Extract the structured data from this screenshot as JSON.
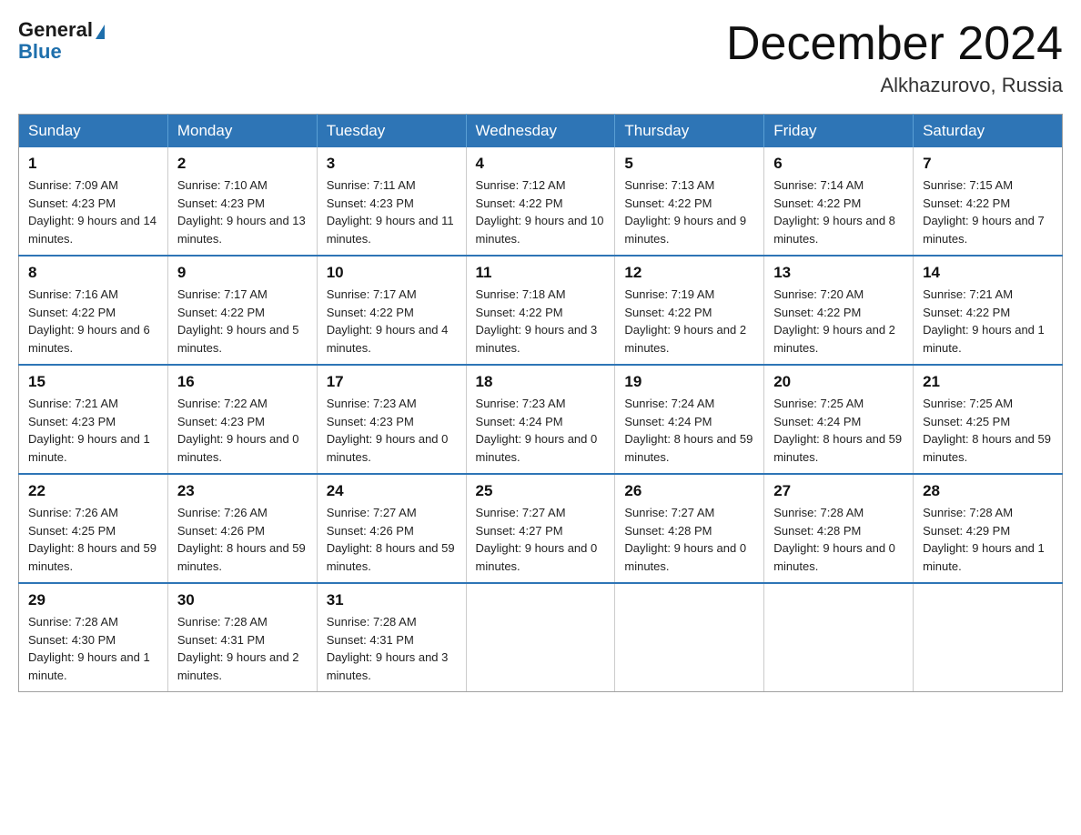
{
  "header": {
    "month": "December 2024",
    "location": "Alkhazurovo, Russia",
    "logo_general": "General",
    "logo_blue": "Blue"
  },
  "weekdays": [
    "Sunday",
    "Monday",
    "Tuesday",
    "Wednesday",
    "Thursday",
    "Friday",
    "Saturday"
  ],
  "weeks": [
    [
      {
        "day": "1",
        "sunrise": "7:09 AM",
        "sunset": "4:23 PM",
        "daylight": "9 hours and 14 minutes."
      },
      {
        "day": "2",
        "sunrise": "7:10 AM",
        "sunset": "4:23 PM",
        "daylight": "9 hours and 13 minutes."
      },
      {
        "day": "3",
        "sunrise": "7:11 AM",
        "sunset": "4:23 PM",
        "daylight": "9 hours and 11 minutes."
      },
      {
        "day": "4",
        "sunrise": "7:12 AM",
        "sunset": "4:22 PM",
        "daylight": "9 hours and 10 minutes."
      },
      {
        "day": "5",
        "sunrise": "7:13 AM",
        "sunset": "4:22 PM",
        "daylight": "9 hours and 9 minutes."
      },
      {
        "day": "6",
        "sunrise": "7:14 AM",
        "sunset": "4:22 PM",
        "daylight": "9 hours and 8 minutes."
      },
      {
        "day": "7",
        "sunrise": "7:15 AM",
        "sunset": "4:22 PM",
        "daylight": "9 hours and 7 minutes."
      }
    ],
    [
      {
        "day": "8",
        "sunrise": "7:16 AM",
        "sunset": "4:22 PM",
        "daylight": "9 hours and 6 minutes."
      },
      {
        "day": "9",
        "sunrise": "7:17 AM",
        "sunset": "4:22 PM",
        "daylight": "9 hours and 5 minutes."
      },
      {
        "day": "10",
        "sunrise": "7:17 AM",
        "sunset": "4:22 PM",
        "daylight": "9 hours and 4 minutes."
      },
      {
        "day": "11",
        "sunrise": "7:18 AM",
        "sunset": "4:22 PM",
        "daylight": "9 hours and 3 minutes."
      },
      {
        "day": "12",
        "sunrise": "7:19 AM",
        "sunset": "4:22 PM",
        "daylight": "9 hours and 2 minutes."
      },
      {
        "day": "13",
        "sunrise": "7:20 AM",
        "sunset": "4:22 PM",
        "daylight": "9 hours and 2 minutes."
      },
      {
        "day": "14",
        "sunrise": "7:21 AM",
        "sunset": "4:22 PM",
        "daylight": "9 hours and 1 minute."
      }
    ],
    [
      {
        "day": "15",
        "sunrise": "7:21 AM",
        "sunset": "4:23 PM",
        "daylight": "9 hours and 1 minute."
      },
      {
        "day": "16",
        "sunrise": "7:22 AM",
        "sunset": "4:23 PM",
        "daylight": "9 hours and 0 minutes."
      },
      {
        "day": "17",
        "sunrise": "7:23 AM",
        "sunset": "4:23 PM",
        "daylight": "9 hours and 0 minutes."
      },
      {
        "day": "18",
        "sunrise": "7:23 AM",
        "sunset": "4:24 PM",
        "daylight": "9 hours and 0 minutes."
      },
      {
        "day": "19",
        "sunrise": "7:24 AM",
        "sunset": "4:24 PM",
        "daylight": "8 hours and 59 minutes."
      },
      {
        "day": "20",
        "sunrise": "7:25 AM",
        "sunset": "4:24 PM",
        "daylight": "8 hours and 59 minutes."
      },
      {
        "day": "21",
        "sunrise": "7:25 AM",
        "sunset": "4:25 PM",
        "daylight": "8 hours and 59 minutes."
      }
    ],
    [
      {
        "day": "22",
        "sunrise": "7:26 AM",
        "sunset": "4:25 PM",
        "daylight": "8 hours and 59 minutes."
      },
      {
        "day": "23",
        "sunrise": "7:26 AM",
        "sunset": "4:26 PM",
        "daylight": "8 hours and 59 minutes."
      },
      {
        "day": "24",
        "sunrise": "7:27 AM",
        "sunset": "4:26 PM",
        "daylight": "8 hours and 59 minutes."
      },
      {
        "day": "25",
        "sunrise": "7:27 AM",
        "sunset": "4:27 PM",
        "daylight": "9 hours and 0 minutes."
      },
      {
        "day": "26",
        "sunrise": "7:27 AM",
        "sunset": "4:28 PM",
        "daylight": "9 hours and 0 minutes."
      },
      {
        "day": "27",
        "sunrise": "7:28 AM",
        "sunset": "4:28 PM",
        "daylight": "9 hours and 0 minutes."
      },
      {
        "day": "28",
        "sunrise": "7:28 AM",
        "sunset": "4:29 PM",
        "daylight": "9 hours and 1 minute."
      }
    ],
    [
      {
        "day": "29",
        "sunrise": "7:28 AM",
        "sunset": "4:30 PM",
        "daylight": "9 hours and 1 minute."
      },
      {
        "day": "30",
        "sunrise": "7:28 AM",
        "sunset": "4:31 PM",
        "daylight": "9 hours and 2 minutes."
      },
      {
        "day": "31",
        "sunrise": "7:28 AM",
        "sunset": "4:31 PM",
        "daylight": "9 hours and 3 minutes."
      },
      null,
      null,
      null,
      null
    ]
  ],
  "labels": {
    "sunrise": "Sunrise:",
    "sunset": "Sunset:",
    "daylight": "Daylight:"
  }
}
